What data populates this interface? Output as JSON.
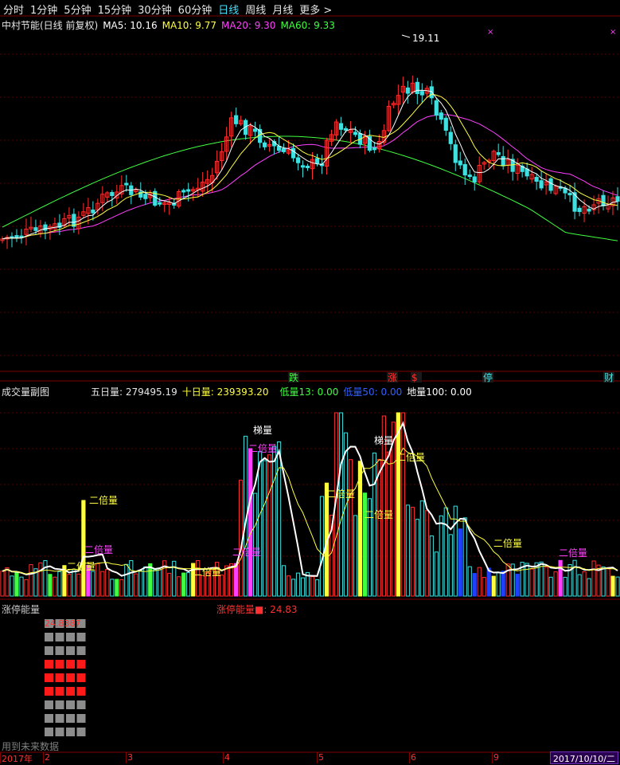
{
  "toolbar": {
    "tabs": [
      "分时",
      "1分钟",
      "5分钟",
      "15分钟",
      "30分钟",
      "60分钟",
      "日线",
      "周线",
      "月线",
      "更多 >"
    ],
    "active_index": 6
  },
  "main_panel": {
    "title": "中村节能(日线 前复权)",
    "ma5_label": "MA5: 10.16",
    "ma10_label": "MA10: 9.77",
    "ma20_label": "MA20: 9.30",
    "ma60_label": "MA60: 9.33",
    "high_marker": "19.11",
    "colors": {
      "ma5": "#ffffff",
      "ma10": "#ffff40",
      "ma20": "#ff40ff",
      "ma60": "#40ff40",
      "up": "#ff3030",
      "down": "#40e0e0"
    },
    "event_tags": [
      {
        "text": "跌",
        "color": "#40ff40"
      },
      {
        "text": "涨",
        "color": "#ff3030"
      },
      {
        "text": "$",
        "color": "#ff3030"
      },
      {
        "text": "停",
        "color": "#40e0e0"
      },
      {
        "text": "财",
        "color": "#40e0e0"
      }
    ]
  },
  "volume_panel": {
    "title": "成交量副图",
    "five_day": "五日量: 279495.19",
    "ten_day": "十日量: 239393.20",
    "low13": "低量13: 0.00",
    "low50": "低量50: 0.00",
    "ground": "地量100: 0.00",
    "annotations": [
      {
        "text": "二倍量",
        "color": "#ffff40"
      },
      {
        "text": "二倍量",
        "color": "#ff40ff"
      },
      {
        "text": "二倍量",
        "color": "#ffff40"
      },
      {
        "text": "二倍量",
        "color": "#ffff40"
      },
      {
        "text": "二倍量",
        "color": "#ff40ff"
      },
      {
        "text": "梯量",
        "color": "#ffffff"
      },
      {
        "text": "二倍量",
        "color": "#ff40ff"
      },
      {
        "text": "二倍量",
        "color": "#ffff40"
      },
      {
        "text": "二倍量",
        "color": "#ffff40"
      },
      {
        "text": "梯量",
        "color": "#ffffff"
      },
      {
        "text": "二倍量",
        "color": "#ffff40"
      },
      {
        "text": "二倍量",
        "color": "#ffff40"
      },
      {
        "text": "二倍量",
        "color": "#ff40ff"
      }
    ]
  },
  "energy_panel": {
    "title": "涨停能量",
    "readout": "涨停能量■: 24.83",
    "grid_label": "24.8387",
    "future_note": "用到未来数据",
    "red_rows": [
      3,
      4,
      5
    ]
  },
  "bottom_axis": {
    "labels": [
      "2017年",
      "2",
      "3",
      "4",
      "5",
      "6",
      "9"
    ],
    "date": "2017/10/10/二"
  }
}
